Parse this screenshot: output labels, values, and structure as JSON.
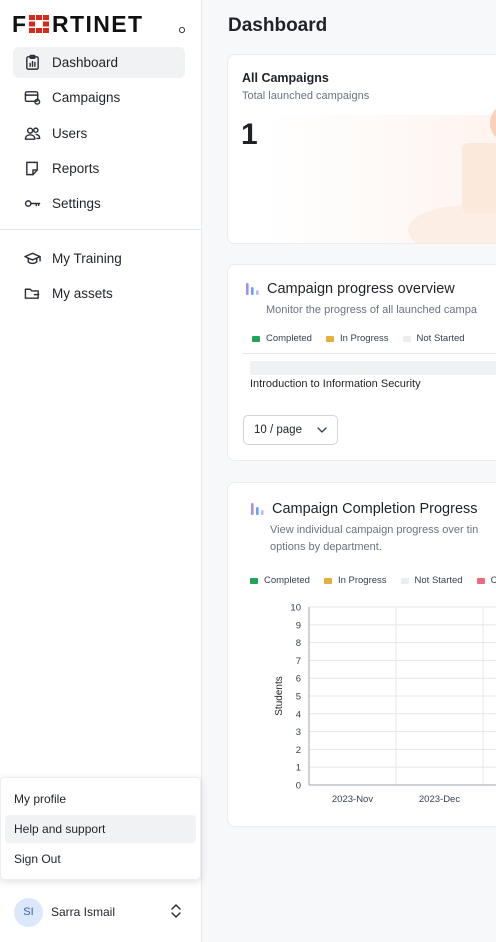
{
  "sidebar": {
    "brand": "FORTINET",
    "items": [
      {
        "label": "Dashboard",
        "icon": "clipboard-chart-icon",
        "active": true
      },
      {
        "label": "Campaigns",
        "icon": "campaign-card-icon"
      },
      {
        "label": "Users",
        "icon": "users-icon"
      },
      {
        "label": "Reports",
        "icon": "report-icon"
      },
      {
        "label": "Settings",
        "icon": "key-icon"
      }
    ],
    "items2": [
      {
        "label": "My Training",
        "icon": "graduation-cap-icon"
      },
      {
        "label": "My assets",
        "icon": "folder-icon"
      }
    ]
  },
  "user_menu": {
    "items": [
      "My profile",
      "Help and support",
      "Sign Out"
    ]
  },
  "user": {
    "initials": "SI",
    "name": "Sarra Ismail"
  },
  "main": {
    "title": "Dashboard",
    "all_campaigns": {
      "title": "All Campaigns",
      "subtitle": "Total launched campaigns",
      "value": "1"
    },
    "progress_overview": {
      "title": "Campaign progress overview",
      "subtitle": "Monitor the progress of all launched campa",
      "legend": [
        "Completed",
        "In Progress",
        "Not Started"
      ],
      "campaign_name": "Introduction to Information Security",
      "page_size": "10 / page"
    },
    "completion_progress": {
      "title": "Campaign Completion Progress",
      "subtitle_line1": "View individual campaign progress over tin",
      "subtitle_line2": "options by department.",
      "legend": [
        "Completed",
        "In Progress",
        "Not Started",
        "C"
      ]
    }
  },
  "colors": {
    "completed": "#22a559",
    "in_progress": "#e2b13c",
    "not_started": "#ebedf0",
    "overdue": "#ef6b7b",
    "active_bg": "#f1f2f4",
    "brand_red": "#da291c"
  },
  "chart_data": {
    "type": "bar",
    "categories": [
      "2023-Nov",
      "2023-Dec"
    ],
    "series": [
      {
        "name": "Completed",
        "values": [
          0,
          0
        ]
      },
      {
        "name": "In Progress",
        "values": [
          0,
          0
        ]
      },
      {
        "name": "Not Started",
        "values": [
          0,
          0
        ]
      }
    ],
    "ylabel": "Students",
    "ylim": [
      0,
      10
    ],
    "yticks": [
      "0",
      "1",
      "2",
      "3",
      "4",
      "5",
      "6",
      "7",
      "8",
      "9",
      "10"
    ],
    "grid": true
  }
}
